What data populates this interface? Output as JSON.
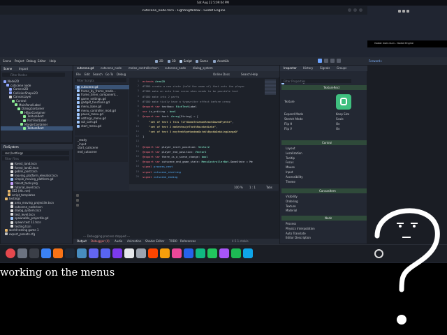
{
  "topbar": {
    "datetime": "Sat Aug 22  5:09:04 PM"
  },
  "ext_text": "Godot main.tscn - Godot Engine",
  "window": {
    "title": "cutscene_node.tscn - FightingWillow - Godot Engine"
  },
  "menus": [
    "Scene",
    "Project",
    "Debug",
    "Editor",
    "Help"
  ],
  "workspaces": [
    "2D",
    "3D",
    "Script",
    "Game",
    "AssetLib"
  ],
  "renderer": "Forward+",
  "scene_dock": {
    "tabs": [
      "Scene",
      "Import"
    ],
    "filter": "Filter Nodes",
    "nodes": [
      "Node2D",
      "cutscene node",
      "Camera2D",
      "CollisionShape2D",
      "CanvasLayer",
      "Control",
      "MainPanelLabel",
      "DialogContainer",
      "HBoxContainer",
      "TextureRect",
      "RichTextLabel",
      "MarginContainer",
      "TextureRect"
    ]
  },
  "fs_dock": {
    "title": "FileSystem",
    "path": "res://settings",
    "filter": "Filter Files",
    "items": [
      "forest_land.tscn",
      "forest_land2.tscn",
      "goblin_post.tscn",
      "moving_platform_elevator.tscn",
      "simple_moving_platform.gd",
      "tileset_tools.png",
      "tutorial_level.tscn",
      "SE2 (Alt..nm)",
      "script_templates",
      "testings",
      "area_moving_projectile.tscn",
      "cutscene_node.tscn",
      "dialog_system.tscn",
      "test_level.tscn",
      "spawnable_projectile.gd",
      "spawn test 11.tscn",
      "testing.tscn",
      "world testing game 1",
      "export_presets.cfg"
    ]
  },
  "script_menu": [
    "File",
    "Edit",
    "Search",
    "Go To",
    "Debug"
  ],
  "script_tabs": [
    "cutscene.gd",
    "cutscene_node",
    "melee_controller.tscn",
    "cutscene_node",
    "dialog_system"
  ],
  "online_docs": "Online Docs",
  "search_help": "Search Help",
  "script_list": {
    "filter": "Filter Scripts",
    "files": [
      "cutscene.gd",
      "frame_by_frame_mode...",
      "frame_timer_component...",
      "game_settings.gd",
      "gadget_functions.gd",
      "menu_base.gd",
      "menu_controller_mod.gd",
      "pause_menu.gd",
      "settings_menu.gd",
      "sot_cam.gd",
      "start_menu.gd"
    ],
    "methods": [
      "_ready",
      "_input",
      "start_cutscene",
      "end_cutscene"
    ]
  },
  "code": {
    "file": "cutscene.gd",
    "lines": [
      {
        "n": "1",
        "parts": [
          [
            "kw",
            "extends "
          ],
          [
            "ty",
            "Area2D"
          ]
        ]
      },
      {
        "n": "2",
        "parts": [
          [
            "cm",
            "#TODO create a new state (hold the name of) that sets the player"
          ]
        ]
      },
      {
        "n": "3",
        "parts": [
          [
            "cm",
            "#TODO make an auto time scene when needs to be possible text"
          ]
        ]
      },
      {
        "n": "4",
        "parts": [
          [
            "cm",
            "#TODO make into 2 parts"
          ]
        ]
      },
      {
        "n": "5",
        "parts": [
          [
            "cm",
            "#TODO make tickly have a typewriter effect before creep"
          ]
        ]
      },
      {
        "n": "6",
        "parts": [
          [
            "kw",
            "@export "
          ],
          [
            "kw",
            "var "
          ],
          [
            "txt",
            "textbox: "
          ],
          [
            "ty",
            "RichText"
          ],
          [
            "txt",
            "Label"
          ]
        ]
      },
      {
        "n": "7",
        "parts": [
          [
            "kw",
            "var "
          ],
          [
            "txt",
            "is_writing : "
          ],
          [
            "ty",
            "bool"
          ]
        ]
      },
      {
        "n": "8",
        "parts": [
          [
            "kw",
            "@export "
          ],
          [
            "kw",
            "var "
          ],
          [
            "txt",
            "text: "
          ],
          [
            "ty",
            "Array"
          ],
          [
            "txt",
            "[String] = ["
          ]
        ]
      },
      {
        "n": "9",
        "parts": [
          [
            "txt",
            "    "
          ],
          [
            "st",
            "\"set of text 1 this TiftOomaTeLemonReachDowedFyethe\""
          ],
          [
            "txt",
            ","
          ]
        ]
      },
      {
        "n": "10",
        "parts": [
          [
            "txt",
            "    "
          ],
          [
            "st",
            "\"set of text 2 mmSehtmujeThothRounkedLeke\""
          ],
          [
            "txt",
            ","
          ]
        ]
      },
      {
        "n": "11",
        "parts": [
          [
            "txt",
            "    "
          ],
          [
            "st",
            "\"set of text 3 mnyfeekRyeHandmmOstaVsByakbDakkingAsegaD\""
          ]
        ]
      },
      {
        "n": "12",
        "parts": [
          [
            "txt",
            "]"
          ]
        ]
      },
      {
        "n": "13",
        "parts": []
      },
      {
        "n": "14",
        "parts": [
          [
            "kw",
            "@export "
          ],
          [
            "kw",
            "var "
          ],
          [
            "txt",
            "player_start_position: "
          ],
          [
            "ty",
            "Vector2"
          ]
        ]
      },
      {
        "n": "15",
        "parts": [
          [
            "kw",
            "@export "
          ],
          [
            "kw",
            "var "
          ],
          [
            "txt",
            "player_end_position: "
          ],
          [
            "ty",
            "Vector2"
          ]
        ]
      },
      {
        "n": "16",
        "parts": [
          [
            "kw",
            "@export "
          ],
          [
            "kw",
            "var "
          ],
          [
            "txt",
            "there_is_a_scene_change: "
          ],
          [
            "ty",
            "bool"
          ]
        ]
      },
      {
        "n": "17",
        "parts": [
          [
            "kw",
            "@export "
          ],
          [
            "kw",
            "var "
          ],
          [
            "txt",
            "cutscene_end_game_state: "
          ],
          [
            "ty",
            "MenuControllerBot"
          ],
          [
            "txt",
            ".GameState = Me"
          ]
        ]
      },
      {
        "n": "18",
        "parts": [
          [
            "kw",
            "signal "
          ],
          [
            "fn",
            "process_next"
          ]
        ]
      },
      {
        "n": "19",
        "parts": [
          [
            "kw",
            "signal "
          ],
          [
            "fn",
            "cutscene_starting"
          ]
        ]
      },
      {
        "n": "20",
        "parts": [
          [
            "kw",
            "signal "
          ],
          [
            "fn",
            "cutscene_ending"
          ]
        ]
      }
    ]
  },
  "status": {
    "zoom": "100 %",
    "pos": "1 : 1",
    "tabs": "Tabs"
  },
  "output": {
    "filter": "Filter Messages",
    "lines": [
      "--- Debugging process stopped ---"
    ]
  },
  "bottom_tabs": [
    "Output",
    "Debugger (4)",
    "Audio",
    "Animation",
    "Shader Editor",
    "TODO",
    "References"
  ],
  "version": "4.5.1.stable",
  "inspector": {
    "tabs": [
      "Inspector",
      "History",
      "Signals",
      "Groups"
    ],
    "file": "cutscene.gd",
    "filter": "Filter Properties",
    "node_type": "TextureRect",
    "props": [
      {
        "k": "Texture",
        "v": ""
      },
      {
        "k": "Expand Mode",
        "v": "Keep Size"
      },
      {
        "k": "Stretch Mode",
        "v": "Scale"
      },
      {
        "k": "Flip H",
        "v": "On"
      },
      {
        "k": "Flip V",
        "v": "On"
      }
    ],
    "control_title": "Control",
    "control_sections": [
      "Layout",
      "Localization",
      "Tooltip",
      "Focus",
      "Mouse",
      "Input",
      "Accessibility",
      "Theme"
    ],
    "canvas_title": "CanvasItem",
    "canvas_sections": [
      "Visibility",
      "Ordering",
      "Texture",
      "Material"
    ],
    "node_title": "Node",
    "node_sections": [
      "Process",
      "Physics Interpolation",
      "Auto Translate",
      "Editor Description"
    ]
  },
  "taskbar": {
    "icons": [
      "vivaldi-icon",
      "files-icon",
      "terminal-icon",
      "photo-icon",
      "firefox-icon",
      "steam-icon",
      "godot-icon",
      "krita-icon",
      "discord-icon",
      "obs-icon",
      "mail-icon",
      "settings-icon",
      "reddit-icon",
      "blender-icon",
      "music-icon",
      "browser-icon",
      "store-icon",
      "game-icon",
      "chat-icon",
      "spotify-icon",
      "vscode-icon"
    ]
  },
  "caption": "working on the menus",
  "colors": {
    "accent": "#4c8fd6",
    "godot_green": "#3fbf7f",
    "bg": "#202531"
  }
}
